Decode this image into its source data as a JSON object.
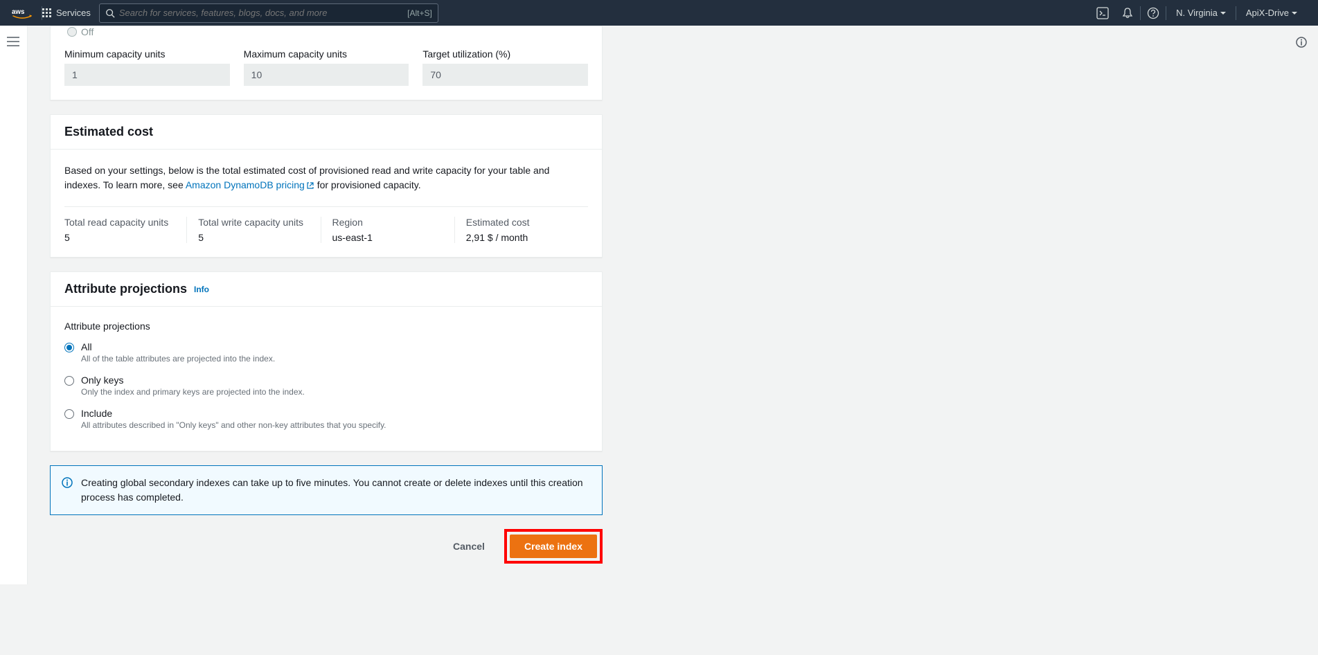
{
  "topnav": {
    "services_label": "Services",
    "search_placeholder": "Search for services, features, blogs, docs, and more",
    "search_shortcut": "[Alt+S]",
    "region": "N. Virginia",
    "account": "ApiX-Drive"
  },
  "capacity": {
    "off_label": "Off",
    "min_label": "Minimum capacity units",
    "min_value": "1",
    "max_label": "Maximum capacity units",
    "max_value": "10",
    "target_label": "Target utilization (%)",
    "target_value": "70"
  },
  "cost": {
    "heading": "Estimated cost",
    "desc_prefix": "Based on your settings, below is the total estimated cost of provisioned read and write capacity for your table and indexes. To learn more, see ",
    "link_text": "Amazon DynamoDB pricing",
    "desc_suffix": " for provisioned capacity.",
    "cells": {
      "read_label": "Total read capacity units",
      "read_value": "5",
      "write_label": "Total write capacity units",
      "write_value": "5",
      "region_label": "Region",
      "region_value": "us-east-1",
      "cost_label": "Estimated cost",
      "cost_value": "2,91 $ / month"
    }
  },
  "projections": {
    "heading": "Attribute projections",
    "info": "Info",
    "subheading": "Attribute projections",
    "options": {
      "all_label": "All",
      "all_desc": "All of the table attributes are projected into the index.",
      "only_keys_label": "Only keys",
      "only_keys_desc": "Only the index and primary keys are projected into the index.",
      "include_label": "Include",
      "include_desc": "All attributes described in \"Only keys\" and other non-key attributes that you specify."
    }
  },
  "alert": {
    "message": "Creating global secondary indexes can take up to five minutes. You cannot create or delete indexes until this creation process has completed."
  },
  "actions": {
    "cancel": "Cancel",
    "create": "Create index"
  }
}
